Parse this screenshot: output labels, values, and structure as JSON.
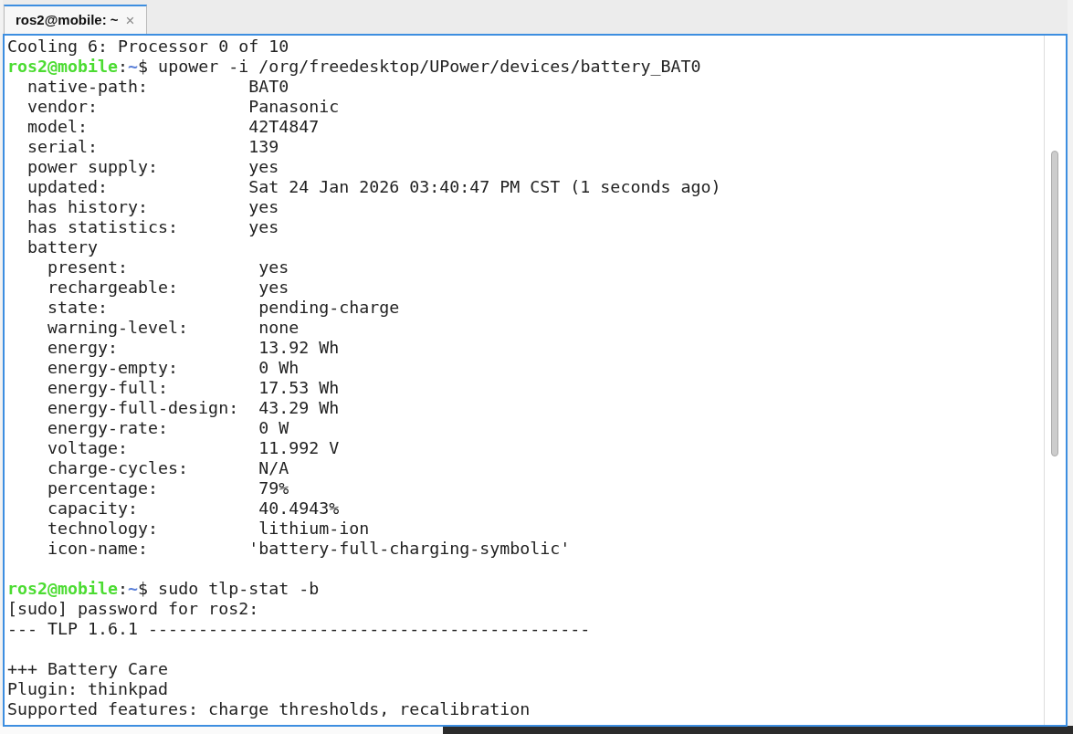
{
  "tabs": [
    {
      "label": "ros2@mobile: ~",
      "close": "×",
      "selected": true
    }
  ],
  "terminal": {
    "lines": [
      {
        "kind": "text",
        "text": "Cooling 6: Processor 0 of 10"
      },
      {
        "kind": "prompt",
        "user": "ros2@mobile",
        "separator": ":",
        "path": "~",
        "command": "$ upower -i /org/freedesktop/UPower/devices/battery_BAT0"
      },
      {
        "kind": "text",
        "text": "  native-path:          BAT0"
      },
      {
        "kind": "text",
        "text": "  vendor:               Panasonic"
      },
      {
        "kind": "text",
        "text": "  model:                42T4847"
      },
      {
        "kind": "text",
        "text": "  serial:               139"
      },
      {
        "kind": "text",
        "text": "  power supply:         yes"
      },
      {
        "kind": "text",
        "text": "  updated:              Sat 24 Jan 2026 03:40:47 PM CST (1 seconds ago)"
      },
      {
        "kind": "text",
        "text": "  has history:          yes"
      },
      {
        "kind": "text",
        "text": "  has statistics:       yes"
      },
      {
        "kind": "text",
        "text": "  battery"
      },
      {
        "kind": "text",
        "text": "    present:             yes"
      },
      {
        "kind": "text",
        "text": "    rechargeable:        yes"
      },
      {
        "kind": "text",
        "text": "    state:               pending-charge"
      },
      {
        "kind": "text",
        "text": "    warning-level:       none"
      },
      {
        "kind": "text",
        "text": "    energy:              13.92 Wh"
      },
      {
        "kind": "text",
        "text": "    energy-empty:        0 Wh"
      },
      {
        "kind": "text",
        "text": "    energy-full:         17.53 Wh"
      },
      {
        "kind": "text",
        "text": "    energy-full-design:  43.29 Wh"
      },
      {
        "kind": "text",
        "text": "    energy-rate:         0 W"
      },
      {
        "kind": "text",
        "text": "    voltage:             11.992 V"
      },
      {
        "kind": "text",
        "text": "    charge-cycles:       N/A"
      },
      {
        "kind": "text",
        "text": "    percentage:          79%"
      },
      {
        "kind": "text",
        "text": "    capacity:            40.4943%"
      },
      {
        "kind": "text",
        "text": "    technology:          lithium-ion"
      },
      {
        "kind": "text",
        "text": "    icon-name:          'battery-full-charging-symbolic'"
      },
      {
        "kind": "blank"
      },
      {
        "kind": "prompt",
        "user": "ros2@mobile",
        "separator": ":",
        "path": "~",
        "command": "$ sudo tlp-stat -b"
      },
      {
        "kind": "text",
        "text": "[sudo] password for ros2:"
      },
      {
        "kind": "text",
        "text": "--- TLP 1.6.1 --------------------------------------------"
      },
      {
        "kind": "blank"
      },
      {
        "kind": "text",
        "text": "+++ Battery Care"
      },
      {
        "kind": "text",
        "text": "Plugin: thinkpad"
      },
      {
        "kind": "text",
        "text": "Supported features: charge thresholds, recalibration"
      }
    ]
  }
}
